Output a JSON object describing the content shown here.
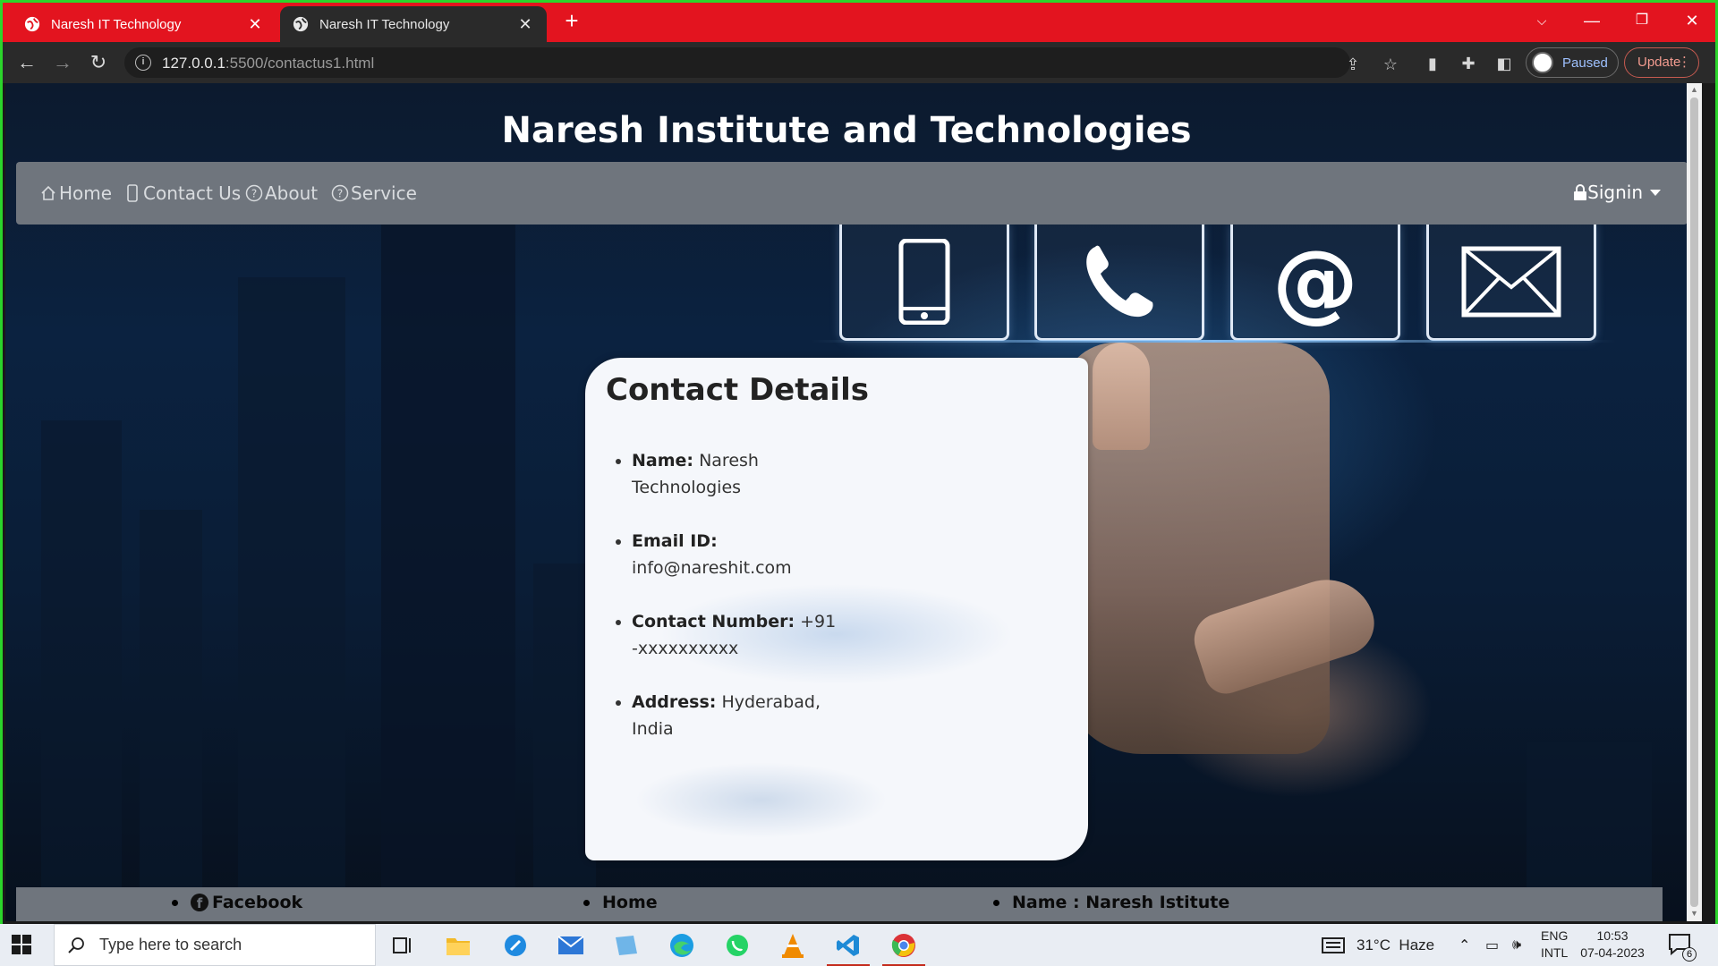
{
  "browser": {
    "tabs": [
      {
        "title": "Naresh IT Technology",
        "active": false
      },
      {
        "title": "Naresh IT Technology",
        "active": true
      }
    ],
    "url_host": "127.0.0.1",
    "url_path": ":5500/contactus1.html",
    "profile_label": "Paused",
    "update_label": "Update"
  },
  "page": {
    "site_title": "Naresh Institute and Technologies",
    "nav": [
      {
        "label": "Home",
        "icon": "house-icon"
      },
      {
        "label": "Contact Us",
        "icon": "phone-icon"
      },
      {
        "label": "About",
        "icon": "question-circle-icon"
      },
      {
        "label": "Service",
        "icon": "question-circle-icon"
      }
    ],
    "signin_label": "Signin",
    "card": {
      "heading": "Contact Details",
      "items": [
        {
          "label": "Name:",
          "value": "Naresh Technologies"
        },
        {
          "label": "Email ID:",
          "value": "info@nareshit.com"
        },
        {
          "label": "Contact Number:",
          "value": "+91-xxxxxxxxxx"
        },
        {
          "label": "Address:",
          "value": "Hyderabad, India"
        }
      ]
    },
    "footer": {
      "facebook": "Facebook",
      "home": "Home",
      "name": "Name : Naresh Istitute"
    }
  },
  "taskbar": {
    "search_placeholder": "Type here to search",
    "weather": "31°C  Haze",
    "lang_top": "ENG",
    "lang_bottom": "INTL",
    "time": "10:53",
    "date": "07-04-2023",
    "notification_count": "6"
  },
  "colors": {
    "tabstrip": "#e3141f",
    "frame": "#2bd52b",
    "navbar": "#6f757d"
  }
}
